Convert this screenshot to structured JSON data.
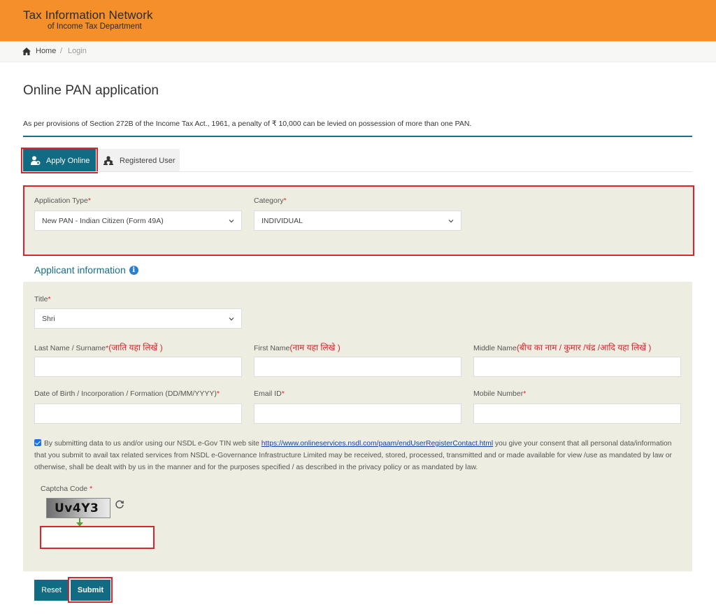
{
  "colors": {
    "header_bg": "#f58f2a",
    "accent_teal": "#116b82",
    "panel_bg": "#eeede1",
    "required": "#d7262d",
    "highlight_box": "#d7262d"
  },
  "header": {
    "logo_line1": "Tax Information Network",
    "logo_line2": "of Income Tax Department"
  },
  "breadcrumb": {
    "home_icon": "home-icon",
    "home": "Home",
    "separator": "/",
    "current": "Login"
  },
  "page": {
    "title": "Online PAN application",
    "notice": "As per provisions of Section 272B of the Income Tax Act., 1961, a penalty of ₹ 10,000 can be levied on possession of more than one PAN."
  },
  "tabs": [
    {
      "label": "Apply Online",
      "icon": "add-user-icon",
      "active": true
    },
    {
      "label": "Registered User",
      "icon": "users-icon",
      "active": false
    }
  ],
  "application": {
    "type_label": "Application Type",
    "type_value": "New PAN - Indian Citizen (Form 49A)",
    "category_label": "Category",
    "category_value": "INDIVIDUAL",
    "required_mark": "*"
  },
  "applicant": {
    "section_title": "Applicant information",
    "info_icon": "info-icon",
    "title_label": "Title",
    "title_value": "Shri",
    "last_name_label": "Last Name / Surname",
    "last_name_hint": "(जाति यहा लिखें )",
    "first_name_label": "First Name",
    "first_name_hint": "(नाम यहा लिखे )",
    "middle_name_label": "Middle Name",
    "middle_name_hint": "(बीच का नाम / कुमार /चंद्र /आदि यहा लिखें )",
    "dob_label": "Date of Birth / Incorporation / Formation (DD/MM/YYYY)",
    "email_label": "Email ID",
    "mobile_label": "Mobile Number",
    "required_mark": "*"
  },
  "consent": {
    "checked": true,
    "text_before": "By submitting data to us and/or using our NSDL e-Gov TIN web site",
    "link": "https://www.onlineservices.nsdl.com/paam/endUserRegisterContact.html",
    "text_after": "you give your consent that all personal data/information that you submit to avail tax related services from NSDL e-Governance Infrastructure Limited may be received, stored, processed, transmitted and or made available for view /use as mandated by law or otherwise, shall be dealt with by us in the manner and for the purposes specified / as described in the privacy policy or as mandated by law."
  },
  "captcha": {
    "label": "Captcha Code",
    "required_mark": "*",
    "code": "Uv4Y3",
    "input_value": ""
  },
  "buttons": {
    "reset": "Reset",
    "submit": "Submit"
  }
}
